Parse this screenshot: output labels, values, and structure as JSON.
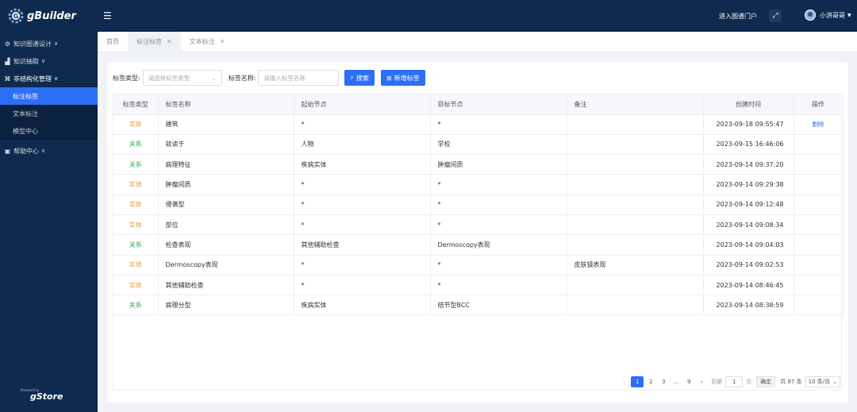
{
  "app": {
    "title": "gBuilder",
    "powered_by": "Powered by",
    "powered_brand": "gStore"
  },
  "sidebar": {
    "items": [
      {
        "label": "知识图谱设计",
        "icon": "gear-icon"
      },
      {
        "label": "知识抽取",
        "icon": "chart-icon"
      },
      {
        "label": "非结构化管理",
        "icon": "puzzle-icon"
      },
      {
        "label": "帮助中心",
        "icon": "help-icon"
      }
    ],
    "sub_items": [
      {
        "label": "标注标签"
      },
      {
        "label": "文本标注"
      },
      {
        "label": "模型中心"
      }
    ]
  },
  "header": {
    "portal_label": "进入图谱门户",
    "user_name": "小洪哥哥"
  },
  "tabs": [
    {
      "label": "首页"
    },
    {
      "label": "标注标签"
    },
    {
      "label": "文本标注"
    }
  ],
  "filters": {
    "type_label": "标签类型:",
    "type_placeholder": "请选择标签类型",
    "name_label": "标签名称:",
    "name_placeholder": "请输入标签名称",
    "search_label": "搜索",
    "add_label": "新增标签"
  },
  "table": {
    "headers": [
      "标签类型",
      "标签名称",
      "起始节点",
      "目标节点",
      "备注",
      "创建时间",
      "操作"
    ],
    "rows": [
      {
        "type": "实体",
        "name": "建筑",
        "start": "*",
        "target": "*",
        "note": "",
        "time": "2023-09-18 09:55:47",
        "action": "删除"
      },
      {
        "type": "关系",
        "name": "就读于",
        "start": "人物",
        "target": "学校",
        "note": "",
        "time": "2023-09-15 16:46:06",
        "action": ""
      },
      {
        "type": "关系",
        "name": "病理特征",
        "start": "疾病实体",
        "target": "肿瘤间质",
        "note": "",
        "time": "2023-09-14 09:37:20",
        "action": ""
      },
      {
        "type": "实体",
        "name": "肿瘤间质",
        "start": "*",
        "target": "*",
        "note": "",
        "time": "2023-09-14 09:29:38",
        "action": ""
      },
      {
        "type": "实体",
        "name": "侵袭型",
        "start": "*",
        "target": "*",
        "note": "",
        "time": "2023-09-14 09:12:48",
        "action": ""
      },
      {
        "type": "实体",
        "name": "部位",
        "start": "*",
        "target": "*",
        "note": "",
        "time": "2023-09-14 09:08:34",
        "action": ""
      },
      {
        "type": "关系",
        "name": "检查表现",
        "start": "其他辅助检查",
        "target": "Dermoscopy表现",
        "note": "",
        "time": "2023-09-14 09:04:03",
        "action": ""
      },
      {
        "type": "实体",
        "name": "Dermoscopy表现",
        "start": "*",
        "target": "*",
        "note": "皮肤镜表现",
        "time": "2023-09-14 09:02:53",
        "action": ""
      },
      {
        "type": "实体",
        "name": "其他辅助检查",
        "start": "*",
        "target": "*",
        "note": "",
        "time": "2023-09-14 08:46:45",
        "action": ""
      },
      {
        "type": "关系",
        "name": "病理分型",
        "start": "疾病实体",
        "target": "结节型BCC",
        "note": "",
        "time": "2023-09-14 08:38:59",
        "action": ""
      }
    ]
  },
  "pagination": {
    "pages": [
      "1",
      "2",
      "3",
      "...",
      "9"
    ],
    "goto_label": "到第",
    "goto_value": "1",
    "page_unit": "页",
    "confirm_label": "确定",
    "total_label": "共 87 条",
    "page_size_label": "10 条/页"
  },
  "colors": {
    "sidebar_bg": "#0e2a4e",
    "accent": "#2d6ef7",
    "entity": "#e6a23c",
    "relation": "#34a853"
  }
}
